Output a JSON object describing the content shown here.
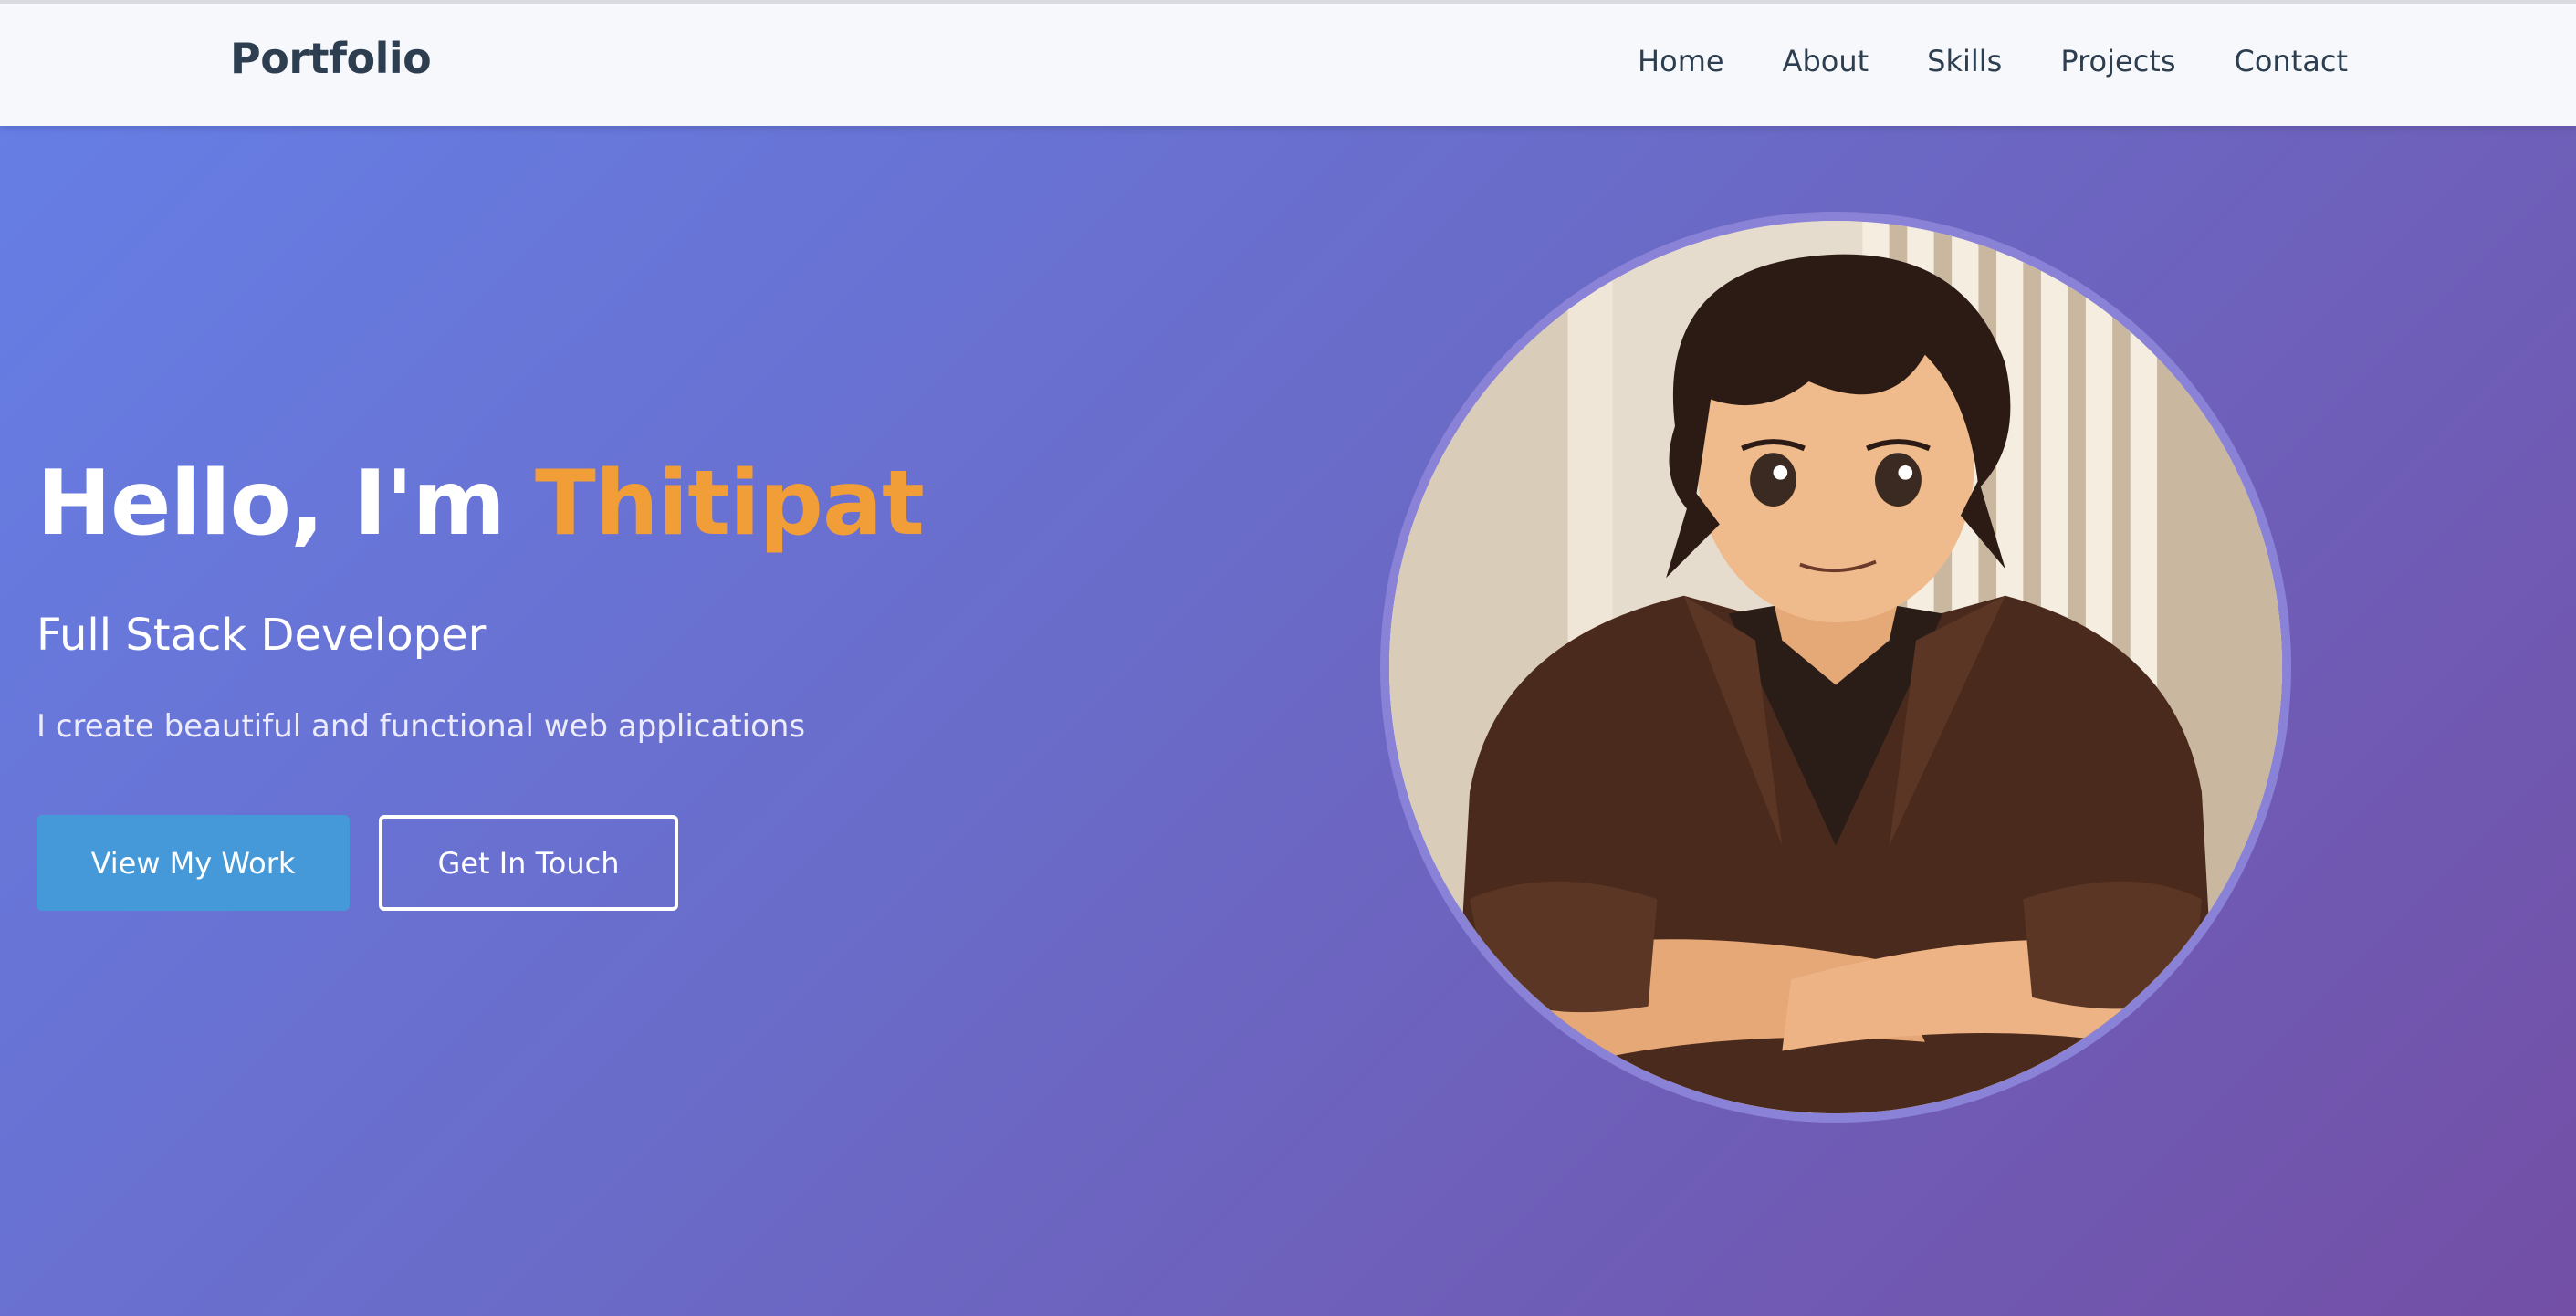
{
  "nav": {
    "logo": "Portfolio",
    "links": [
      "Home",
      "About",
      "Skills",
      "Projects",
      "Contact"
    ]
  },
  "hero": {
    "greeting": "Hello, I'm ",
    "name": "Thitipat",
    "subtitle": "Full Stack Developer",
    "tagline": "I create beautiful and functional web applications",
    "primary_button": "View My Work",
    "secondary_button": "Get In Touch",
    "avatar_icon": "anime-portrait-image"
  },
  "colors": {
    "accent_name": "#f19d38",
    "primary_button": "#4599d8",
    "nav_text": "#2c3e50"
  }
}
